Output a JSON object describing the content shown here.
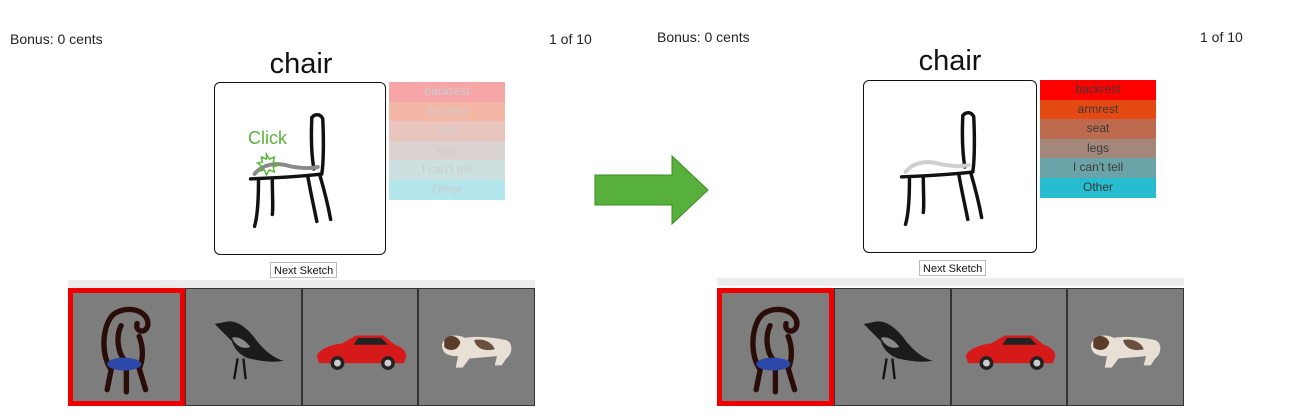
{
  "left": {
    "bonus": "Bonus: 0 cents",
    "counter": "1 of 10",
    "title": "chair",
    "click_hint": "Click",
    "labels": [
      {
        "text": "backrest",
        "color": "#f7a6a8"
      },
      {
        "text": "armrest",
        "color": "#f4b7a5"
      },
      {
        "text": "seat",
        "color": "#e9c5bd"
      },
      {
        "text": "legs",
        "color": "#dbd3cf"
      },
      {
        "text": "I can't tell",
        "color": "#cce0e0"
      },
      {
        "text": "Other",
        "color": "#b3e6ec"
      }
    ],
    "next_button": "Next Sketch",
    "thumbnails": [
      {
        "icon": "chair-icon",
        "selected": true
      },
      {
        "icon": "crow-icon",
        "selected": false
      },
      {
        "icon": "car-icon",
        "selected": false
      },
      {
        "icon": "dog-icon",
        "selected": false
      }
    ]
  },
  "right": {
    "bonus": "Bonus: 0 cents",
    "counter": "1 of 10",
    "title": "chair",
    "labels": [
      {
        "text": "backrest",
        "color": "#ff0000"
      },
      {
        "text": "armrest",
        "color": "#e54a12"
      },
      {
        "text": "seat",
        "color": "#bd6a4e"
      },
      {
        "text": "legs",
        "color": "#a3877a"
      },
      {
        "text": "I can't tell",
        "color": "#6ba4a8"
      },
      {
        "text": "Other",
        "color": "#27bccf"
      }
    ],
    "next_button": "Next Sketch",
    "thumbnails": [
      {
        "icon": "chair-icon",
        "selected": true
      },
      {
        "icon": "crow-icon",
        "selected": false
      },
      {
        "icon": "car-icon",
        "selected": false
      },
      {
        "icon": "dog-icon",
        "selected": false
      }
    ]
  },
  "arrow_color": "#57b03b"
}
